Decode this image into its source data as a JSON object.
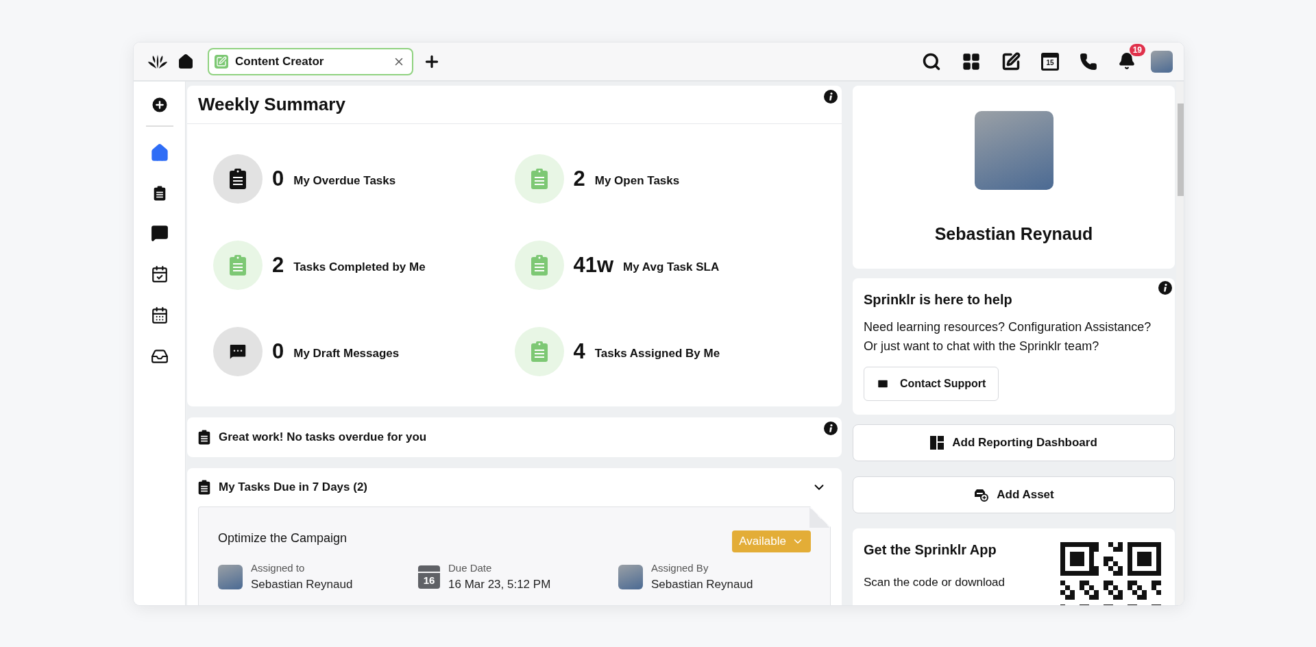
{
  "top_bar": {
    "tab": {
      "label": "Content Creator",
      "selected": true
    },
    "calendar_day": "15",
    "notification_count": "19"
  },
  "sidebar": {
    "items": [
      {
        "kind": "add",
        "selected": false
      },
      {
        "kind": "home",
        "selected": true
      },
      {
        "kind": "tasks",
        "selected": false
      },
      {
        "kind": "messages",
        "selected": false
      },
      {
        "kind": "approvals",
        "selected": false
      },
      {
        "kind": "calendar",
        "selected": false
      },
      {
        "kind": "inbox",
        "selected": false
      }
    ]
  },
  "weekly_summary": {
    "title": "Weekly Summary",
    "stats": [
      {
        "kind": "task",
        "active": false,
        "value": "0",
        "label": "My Overdue Tasks"
      },
      {
        "kind": "task",
        "active": true,
        "value": "2",
        "label": "My Open Tasks"
      },
      {
        "kind": "task",
        "active": true,
        "value": "2",
        "label": "Tasks Completed by Me"
      },
      {
        "kind": "task",
        "active": true,
        "value": "41w",
        "label": "My Avg Task SLA"
      },
      {
        "kind": "message",
        "active": false,
        "value": "0",
        "label": "My Draft Messages"
      },
      {
        "kind": "task",
        "active": true,
        "value": "4",
        "label": "Tasks Assigned By Me"
      }
    ]
  },
  "overdue_notice": {
    "text": "Great work! No tasks overdue for you"
  },
  "tasks_due": {
    "title": "My Tasks Due in 7 Days (2)",
    "expanded": true,
    "tasks": [
      {
        "title": "Optimize the Campaign",
        "status": "Available",
        "assigned_to_label": "Assigned to",
        "assigned_to": "Sebastian Reynaud",
        "due_label": "Due Date",
        "due_day": "16",
        "due_date": "16 Mar 23, 5:12 PM",
        "assigned_by_label": "Assigned By",
        "assigned_by": "Sebastian Reynaud"
      }
    ]
  },
  "profile": {
    "name": "Sebastian Reynaud"
  },
  "help": {
    "title": "Sprinklr is here to help",
    "text": "Need learning resources? Configuration Assistance? Or just want to chat with the Sprinklr team?",
    "button": "Contact Support"
  },
  "actions": [
    {
      "kind": "dashboard",
      "label": "Add Reporting Dashboard"
    },
    {
      "kind": "asset",
      "label": "Add Asset"
    }
  ],
  "app_promo": {
    "title": "Get the Sprinklr App",
    "text": "Scan the code or download"
  }
}
